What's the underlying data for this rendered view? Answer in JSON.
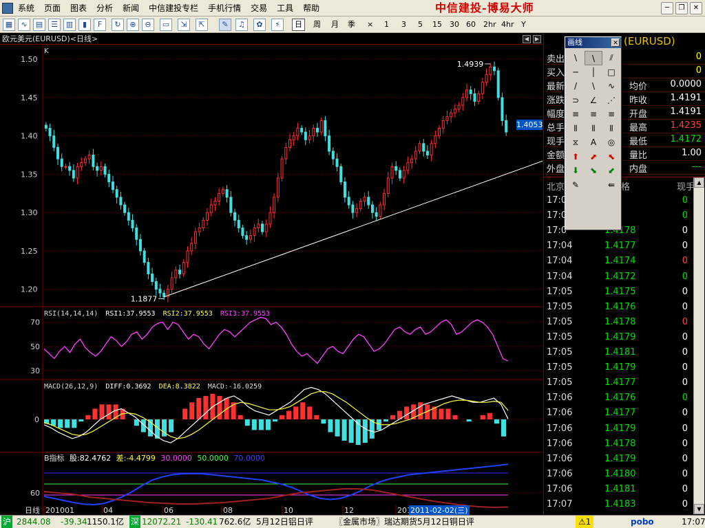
{
  "menu": {
    "items": [
      "系统",
      "页面",
      "图表",
      "分析",
      "新闻",
      "中信建投专栏",
      "手机行情",
      "交易",
      "工具",
      "帮助"
    ],
    "brand": "中信建投-博易大师"
  },
  "window_buttons": {
    "min": "─",
    "restore": "❐",
    "close": "✕"
  },
  "toolbar": {
    "periods": [
      "日",
      "周",
      "月",
      "季",
      "×",
      "1",
      "3",
      "5",
      "15",
      "30",
      "60",
      "2hr",
      "4hr",
      "Y"
    ],
    "active_period": "日"
  },
  "chart": {
    "title": "欧元美元(EURUSD)<日线>",
    "k_label": "K",
    "current_price": "1.4053",
    "high_label": "1.4939",
    "low_label": "1.1877",
    "rsi_header": {
      "params": "RSI(14,14,14)",
      "rsi1": "RSI1:37.9553",
      "rsi2": "RSI2:37.9553",
      "rsi3": "RSI3:37.9553"
    },
    "macd_header": {
      "params": "MACD(26,12,9)",
      "diff": "DIFF:0.3692",
      "dea": "DEA:8.3822",
      "macd": "MACD:-16.0259"
    },
    "b_header": {
      "name": "B指标",
      "gu": "股:82.4762",
      "cha": "差:-4.4799",
      "v30": "30.0000",
      "v50": "50.0000",
      "v70": "70.0000"
    },
    "x_axis": {
      "lead": "日线",
      "labels": [
        "201001",
        "04",
        "06",
        "08",
        "10",
        "12",
        "201"
      ],
      "cursor_date": "2011-02-02(三)"
    }
  },
  "chart_data": [
    {
      "type": "candlestick",
      "title": "欧元美元(EURUSD)<日线>",
      "y_ticks": [
        1.2,
        1.25,
        1.3,
        1.35,
        1.4,
        1.45,
        1.5
      ],
      "ylim": [
        1.18,
        1.51
      ],
      "annotations": [
        {
          "text": "1.4939",
          "value": 1.4939
        },
        {
          "text": "1.1877",
          "value": 1.1877
        }
      ],
      "trendline": {
        "start": [
          "2010-06",
          1.19
        ],
        "end": [
          "2011-02",
          1.36
        ]
      },
      "close_path": [
        1.41,
        1.4,
        1.385,
        1.37,
        1.36,
        1.36,
        1.355,
        1.345,
        1.36,
        1.365,
        1.37,
        1.375,
        1.36,
        1.355,
        1.36,
        1.35,
        1.34,
        1.33,
        1.32,
        1.31,
        1.3,
        1.29,
        1.28,
        1.265,
        1.25,
        1.235,
        1.22,
        1.21,
        1.2,
        1.195,
        1.19,
        1.2,
        1.215,
        1.225,
        1.22,
        1.235,
        1.25,
        1.26,
        1.275,
        1.28,
        1.29,
        1.3,
        1.31,
        1.315,
        1.325,
        1.33,
        1.32,
        1.3,
        1.29,
        1.28,
        1.27,
        1.265,
        1.27,
        1.28,
        1.285,
        1.275,
        1.285,
        1.3,
        1.32,
        1.345,
        1.37,
        1.385,
        1.395,
        1.4,
        1.41,
        1.405,
        1.395,
        1.4,
        1.41,
        1.405,
        1.42,
        1.4,
        1.38,
        1.37,
        1.36,
        1.34,
        1.32,
        1.31,
        1.3,
        1.305,
        1.315,
        1.32,
        1.31,
        1.3,
        1.295,
        1.31,
        1.325,
        1.345,
        1.36,
        1.355,
        1.345,
        1.355,
        1.365,
        1.37,
        1.38,
        1.39,
        1.38,
        1.375,
        1.39,
        1.4,
        1.41,
        1.42,
        1.425,
        1.43,
        1.435,
        1.44,
        1.45,
        1.46,
        1.455,
        1.445,
        1.455,
        1.47,
        1.48,
        1.49,
        1.485,
        1.45,
        1.42,
        1.405
      ]
    },
    {
      "type": "line",
      "title": "RSI(14,14,14)",
      "y_ticks": [
        30,
        50,
        70
      ],
      "ylim": [
        25,
        80
      ],
      "series": [
        {
          "name": "RSI1",
          "color": "#ff40ff",
          "values": [
            48,
            44,
            40,
            46,
            50,
            45,
            52,
            56,
            49,
            45,
            42,
            46,
            52,
            58,
            55,
            50,
            54,
            60,
            62,
            56,
            60,
            66,
            69,
            70,
            64,
            70,
            68,
            62,
            56,
            60,
            58,
            52,
            48,
            54,
            60,
            64,
            62,
            58,
            62,
            66,
            70,
            72,
            74,
            73,
            68,
            70,
            66,
            60,
            52,
            46,
            42,
            44,
            40,
            36,
            42,
            48,
            50,
            46,
            44,
            50,
            56,
            60,
            58,
            52,
            46,
            48,
            52,
            58,
            64,
            66,
            62,
            60,
            64,
            66,
            60,
            62,
            66,
            70,
            72,
            68,
            60,
            62,
            66,
            70,
            72,
            70,
            66,
            60,
            50,
            40,
            37.9553
          ]
        }
      ]
    },
    {
      "type": "bar",
      "title": "MACD(26,12,9)",
      "y_ticks": [
        0
      ],
      "series": [
        {
          "name": "DIFF",
          "color": "#ffffff",
          "values": [
            -5,
            -8,
            -12,
            -15,
            -18,
            -16,
            -12,
            -6,
            0,
            4,
            8,
            10,
            6,
            2,
            -4,
            -10,
            -16,
            -20,
            -22,
            -18,
            -12,
            -6,
            0,
            6,
            12,
            16,
            20,
            22,
            18,
            12,
            8,
            6,
            4,
            8,
            12,
            16,
            22,
            28,
            30,
            28,
            24,
            18,
            12,
            6,
            0,
            -6,
            -10,
            -12,
            -10,
            -6,
            -2,
            2,
            6,
            10,
            14,
            16,
            18,
            20,
            22,
            20,
            18,
            16,
            16,
            18,
            20,
            14,
            0.3692
          ]
        },
        {
          "name": "DEA",
          "color": "#ffff40",
          "values": [
            -3,
            -5,
            -8,
            -11,
            -14,
            -15,
            -14,
            -11,
            -7,
            -3,
            1,
            5,
            6,
            5,
            2,
            -2,
            -7,
            -12,
            -16,
            -18,
            -17,
            -14,
            -10,
            -5,
            0,
            5,
            10,
            14,
            16,
            15,
            13,
            11,
            9,
            9,
            10,
            12,
            16,
            20,
            24,
            26,
            26,
            24,
            20,
            16,
            11,
            6,
            1,
            -3,
            -5,
            -5,
            -4,
            -2,
            0,
            3,
            6,
            9,
            12,
            15,
            17,
            18,
            18,
            17,
            16,
            16,
            17,
            16,
            8.3822
          ]
        },
        {
          "name": "MACD",
          "values": [
            -4,
            -6,
            -8,
            -8,
            -8,
            -2,
            4,
            10,
            14,
            14,
            14,
            10,
            0,
            -6,
            -12,
            -16,
            -18,
            -16,
            -12,
            0,
            10,
            16,
            20,
            22,
            24,
            22,
            20,
            16,
            4,
            -6,
            -10,
            -10,
            -10,
            -2,
            4,
            8,
            12,
            16,
            12,
            4,
            -4,
            -12,
            -16,
            -20,
            -22,
            -24,
            -22,
            -18,
            -10,
            -2,
            4,
            8,
            12,
            14,
            16,
            14,
            12,
            10,
            10,
            4,
            0,
            -2,
            0,
            4,
            6,
            -4,
            -16.0259
          ]
        }
      ]
    },
    {
      "type": "line",
      "title": "B指标",
      "y_ticks": [
        60
      ],
      "series": [
        {
          "name": "股",
          "color": "#3030ff",
          "values": [
            20,
            16,
            12,
            8,
            5,
            4,
            6,
            12,
            20,
            30,
            42,
            52,
            58,
            62,
            64,
            64,
            64,
            62,
            60,
            58,
            56,
            54,
            52,
            48,
            44,
            38,
            30,
            22,
            16,
            14,
            16,
            22,
            30,
            40,
            48,
            54,
            58,
            62,
            64,
            66,
            68,
            70,
            72,
            74,
            76,
            78,
            80,
            82.4762
          ]
        },
        {
          "name": "差",
          "color": "#ff3030",
          "values": [
            18,
            16,
            14,
            10,
            8,
            6,
            4,
            2,
            1,
            0,
            0,
            1,
            2,
            4,
            6,
            8,
            12,
            16,
            18,
            20,
            22,
            22,
            20,
            16,
            12,
            8,
            4,
            1,
            -2,
            -4,
            -5,
            -4.4799
          ]
        },
        {
          "name": "30.0000",
          "values": [
            30
          ]
        },
        {
          "name": "50.0000",
          "values": [
            50
          ]
        },
        {
          "name": "70.0000",
          "values": [
            70
          ]
        }
      ]
    }
  ],
  "quote": {
    "code": "(EURUSD)",
    "rows": [
      {
        "k1": "卖出",
        "v1": "0",
        "k2": "",
        "v2": "0",
        "v2_color": "#ffff00"
      },
      {
        "k1": "买入",
        "v1": "",
        "k2": "",
        "v2": "0",
        "v2_color": "#ffff00"
      },
      {
        "k1": "最新",
        "v1": "",
        "k2": "均价",
        "v2": "0.0000",
        "v2_color": "#ffffff"
      },
      {
        "k1": "涨跌",
        "v1": "",
        "k2": "昨收",
        "v2": "1.4191",
        "v2_color": "#ffffff"
      },
      {
        "k1": "幅度",
        "v1": "",
        "k2": "开盘",
        "v2": "1.4191",
        "v2_color": "#ffffff"
      },
      {
        "k1": "总手",
        "v1": "",
        "k2": "最高",
        "v2": "1.4235",
        "v2_color": "#ff4040"
      },
      {
        "k1": "现手",
        "v1": "",
        "k2": "最低",
        "v2": "1.4172",
        "v2_color": "#00e000"
      },
      {
        "k1": "金额",
        "v1": "",
        "k2": "量比",
        "v2": "1.00",
        "v2_color": "#ffffff"
      },
      {
        "k1": "外盘",
        "v1": "",
        "k2": "内盘",
        "v2": "---",
        "v2_color": "#00e000"
      }
    ],
    "ticks_header": {
      "time": "北京",
      "price": "格",
      "vol": "现手"
    },
    "ticks": [
      {
        "time": "17:0",
        "price": "78",
        "vol": "0",
        "vcolor": "#00e000"
      },
      {
        "time": "17:0",
        "price": "77",
        "vol": "0",
        "vcolor": "#00e000"
      },
      {
        "time": "17:0",
        "price": "1.4178",
        "vol": "0",
        "vcolor": "#ffffff"
      },
      {
        "time": "17:04",
        "price": "1.4177",
        "vol": "0",
        "vcolor": "#ffffff"
      },
      {
        "time": "17:04",
        "price": "1.4174",
        "vol": "0",
        "vcolor": "#ff4040"
      },
      {
        "time": "17:04",
        "price": "1.4172",
        "vol": "0",
        "vcolor": "#00e000"
      },
      {
        "time": "17:05",
        "price": "1.4175",
        "vol": "0",
        "vcolor": "#ffffff"
      },
      {
        "time": "17:05",
        "price": "1.4176",
        "vol": "0",
        "vcolor": "#ffffff"
      },
      {
        "time": "17:05",
        "price": "1.4178",
        "vol": "0",
        "vcolor": "#ff4040"
      },
      {
        "time": "17:05",
        "price": "1.4179",
        "vol": "0",
        "vcolor": "#ffffff"
      },
      {
        "time": "17:05",
        "price": "1.4181",
        "vol": "0",
        "vcolor": "#ffffff"
      },
      {
        "time": "17:05",
        "price": "1.4179",
        "vol": "0",
        "vcolor": "#ffffff"
      },
      {
        "time": "17:05",
        "price": "1.4177",
        "vol": "0",
        "vcolor": "#ffffff"
      },
      {
        "time": "17:06",
        "price": "1.4176",
        "vol": "0",
        "vcolor": "#00e000"
      },
      {
        "time": "17:06",
        "price": "1.4177",
        "vol": "0",
        "vcolor": "#ffffff"
      },
      {
        "time": "17:06",
        "price": "1.4179",
        "vol": "0",
        "vcolor": "#ffffff"
      },
      {
        "time": "17:06",
        "price": "1.4178",
        "vol": "0",
        "vcolor": "#ffffff"
      },
      {
        "time": "17:06",
        "price": "1.4179",
        "vol": "0",
        "vcolor": "#ffffff"
      },
      {
        "time": "17:06",
        "price": "1.4180",
        "vol": "0",
        "vcolor": "#ffffff"
      },
      {
        "time": "17:06",
        "price": "1.4181",
        "vol": "0",
        "vcolor": "#ffffff"
      },
      {
        "time": "17:07",
        "price": "1.4183",
        "vol": "0",
        "vcolor": "#ffffff"
      }
    ]
  },
  "toolbox": {
    "title": "画线",
    "close": "✕",
    "tools": [
      "\\",
      "\\",
      "⫽",
      "─",
      "│",
      "□",
      "/",
      "\\",
      "∿",
      "⊃",
      "∠",
      "⋰",
      "≡",
      "≡",
      "≡",
      "⦀",
      "⦀",
      "⦀",
      "⧖",
      "A",
      "◎",
      "⬆",
      "⬈",
      "⬉",
      "⬇",
      "⬊",
      "⬋",
      "✎",
      "",
      "⇚"
    ]
  },
  "statusbar": {
    "sh": "沪",
    "sh_index": "2844.08",
    "sh_change": "-39.34",
    "sh_amount": "1150.1亿",
    "sz": "深",
    "sz_index": "12072.21",
    "sz_change": "-130.41",
    "sz_amount": "762.6亿",
    "news": "5月12日铝日评",
    "market": "〖金属市场〗瑞达期货5月12日铜日评",
    "alert": "⚠1",
    "logo": "pobo",
    "time": "17:07"
  }
}
